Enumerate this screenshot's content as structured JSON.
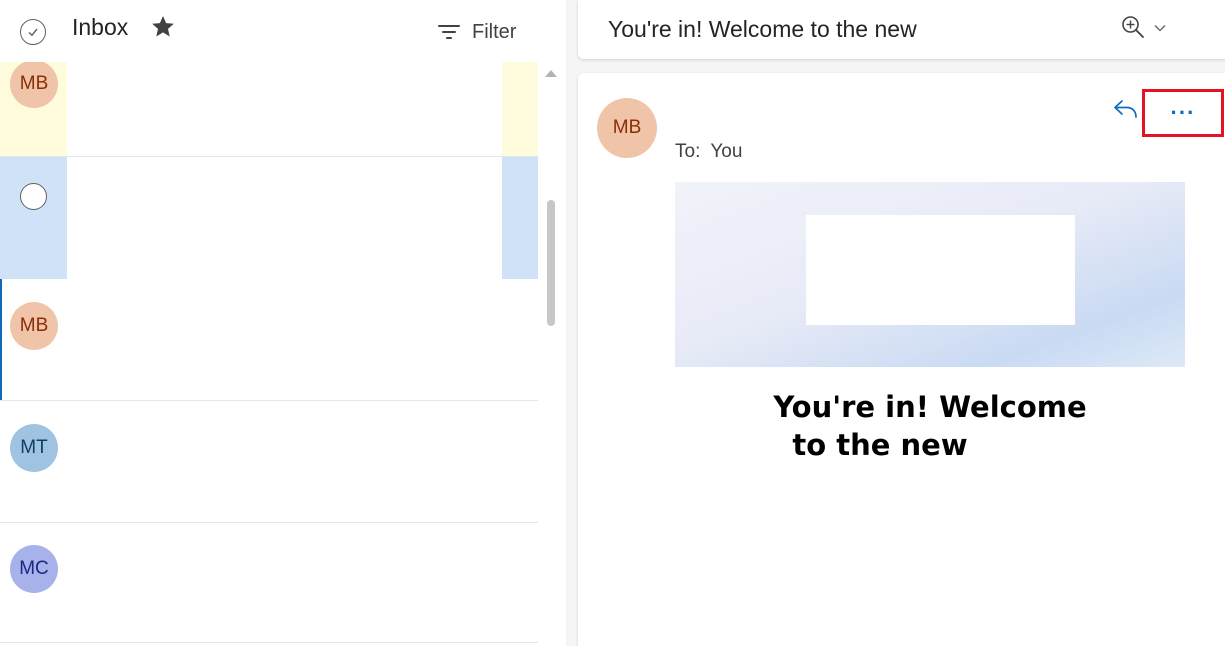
{
  "list": {
    "title": "Inbox",
    "filter_label": "Filter",
    "icons": {
      "select_all": "check-circle-icon",
      "favorite": "star-icon",
      "filter": "filter-lines-icon"
    }
  },
  "messages": [
    {
      "initials": "MB",
      "avatar_bg": "#f0c4a8",
      "avatar_fg": "#8a2e05",
      "row_bg": "#fffbdd",
      "state": "pinned"
    },
    {
      "initials": "",
      "avatar_bg": "",
      "avatar_fg": "",
      "row_bg": "#cfe2f8",
      "state": "hover-checkbox"
    },
    {
      "initials": "MB",
      "avatar_bg": "#f0c4a8",
      "avatar_fg": "#8a2e05",
      "row_bg": "#ffffff",
      "state": "selected"
    },
    {
      "initials": "MT",
      "avatar_bg": "#9fc3e0",
      "avatar_fg": "#0f3f66",
      "row_bg": "#ffffff",
      "state": "normal"
    },
    {
      "initials": "MC",
      "avatar_bg": "#a7b1ea",
      "avatar_fg": "#1e2880",
      "row_bg": "#ffffff",
      "state": "normal"
    }
  ],
  "reading": {
    "subject": "You're in! Welcome to the new",
    "zoom_icon": "zoom-in-icon",
    "sender_initials": "MB",
    "sender_avatar_bg": "#f0c4a8",
    "sender_avatar_fg": "#8a2e05",
    "to_label": "To:",
    "to_value": "You",
    "reply_icon": "reply-arrow-icon",
    "more_label": "···",
    "headline_line1": "You're in! Welcome",
    "headline_line2": "to the new"
  },
  "colors": {
    "accent": "#0f6cbd",
    "highlight_border": "#e81123"
  }
}
